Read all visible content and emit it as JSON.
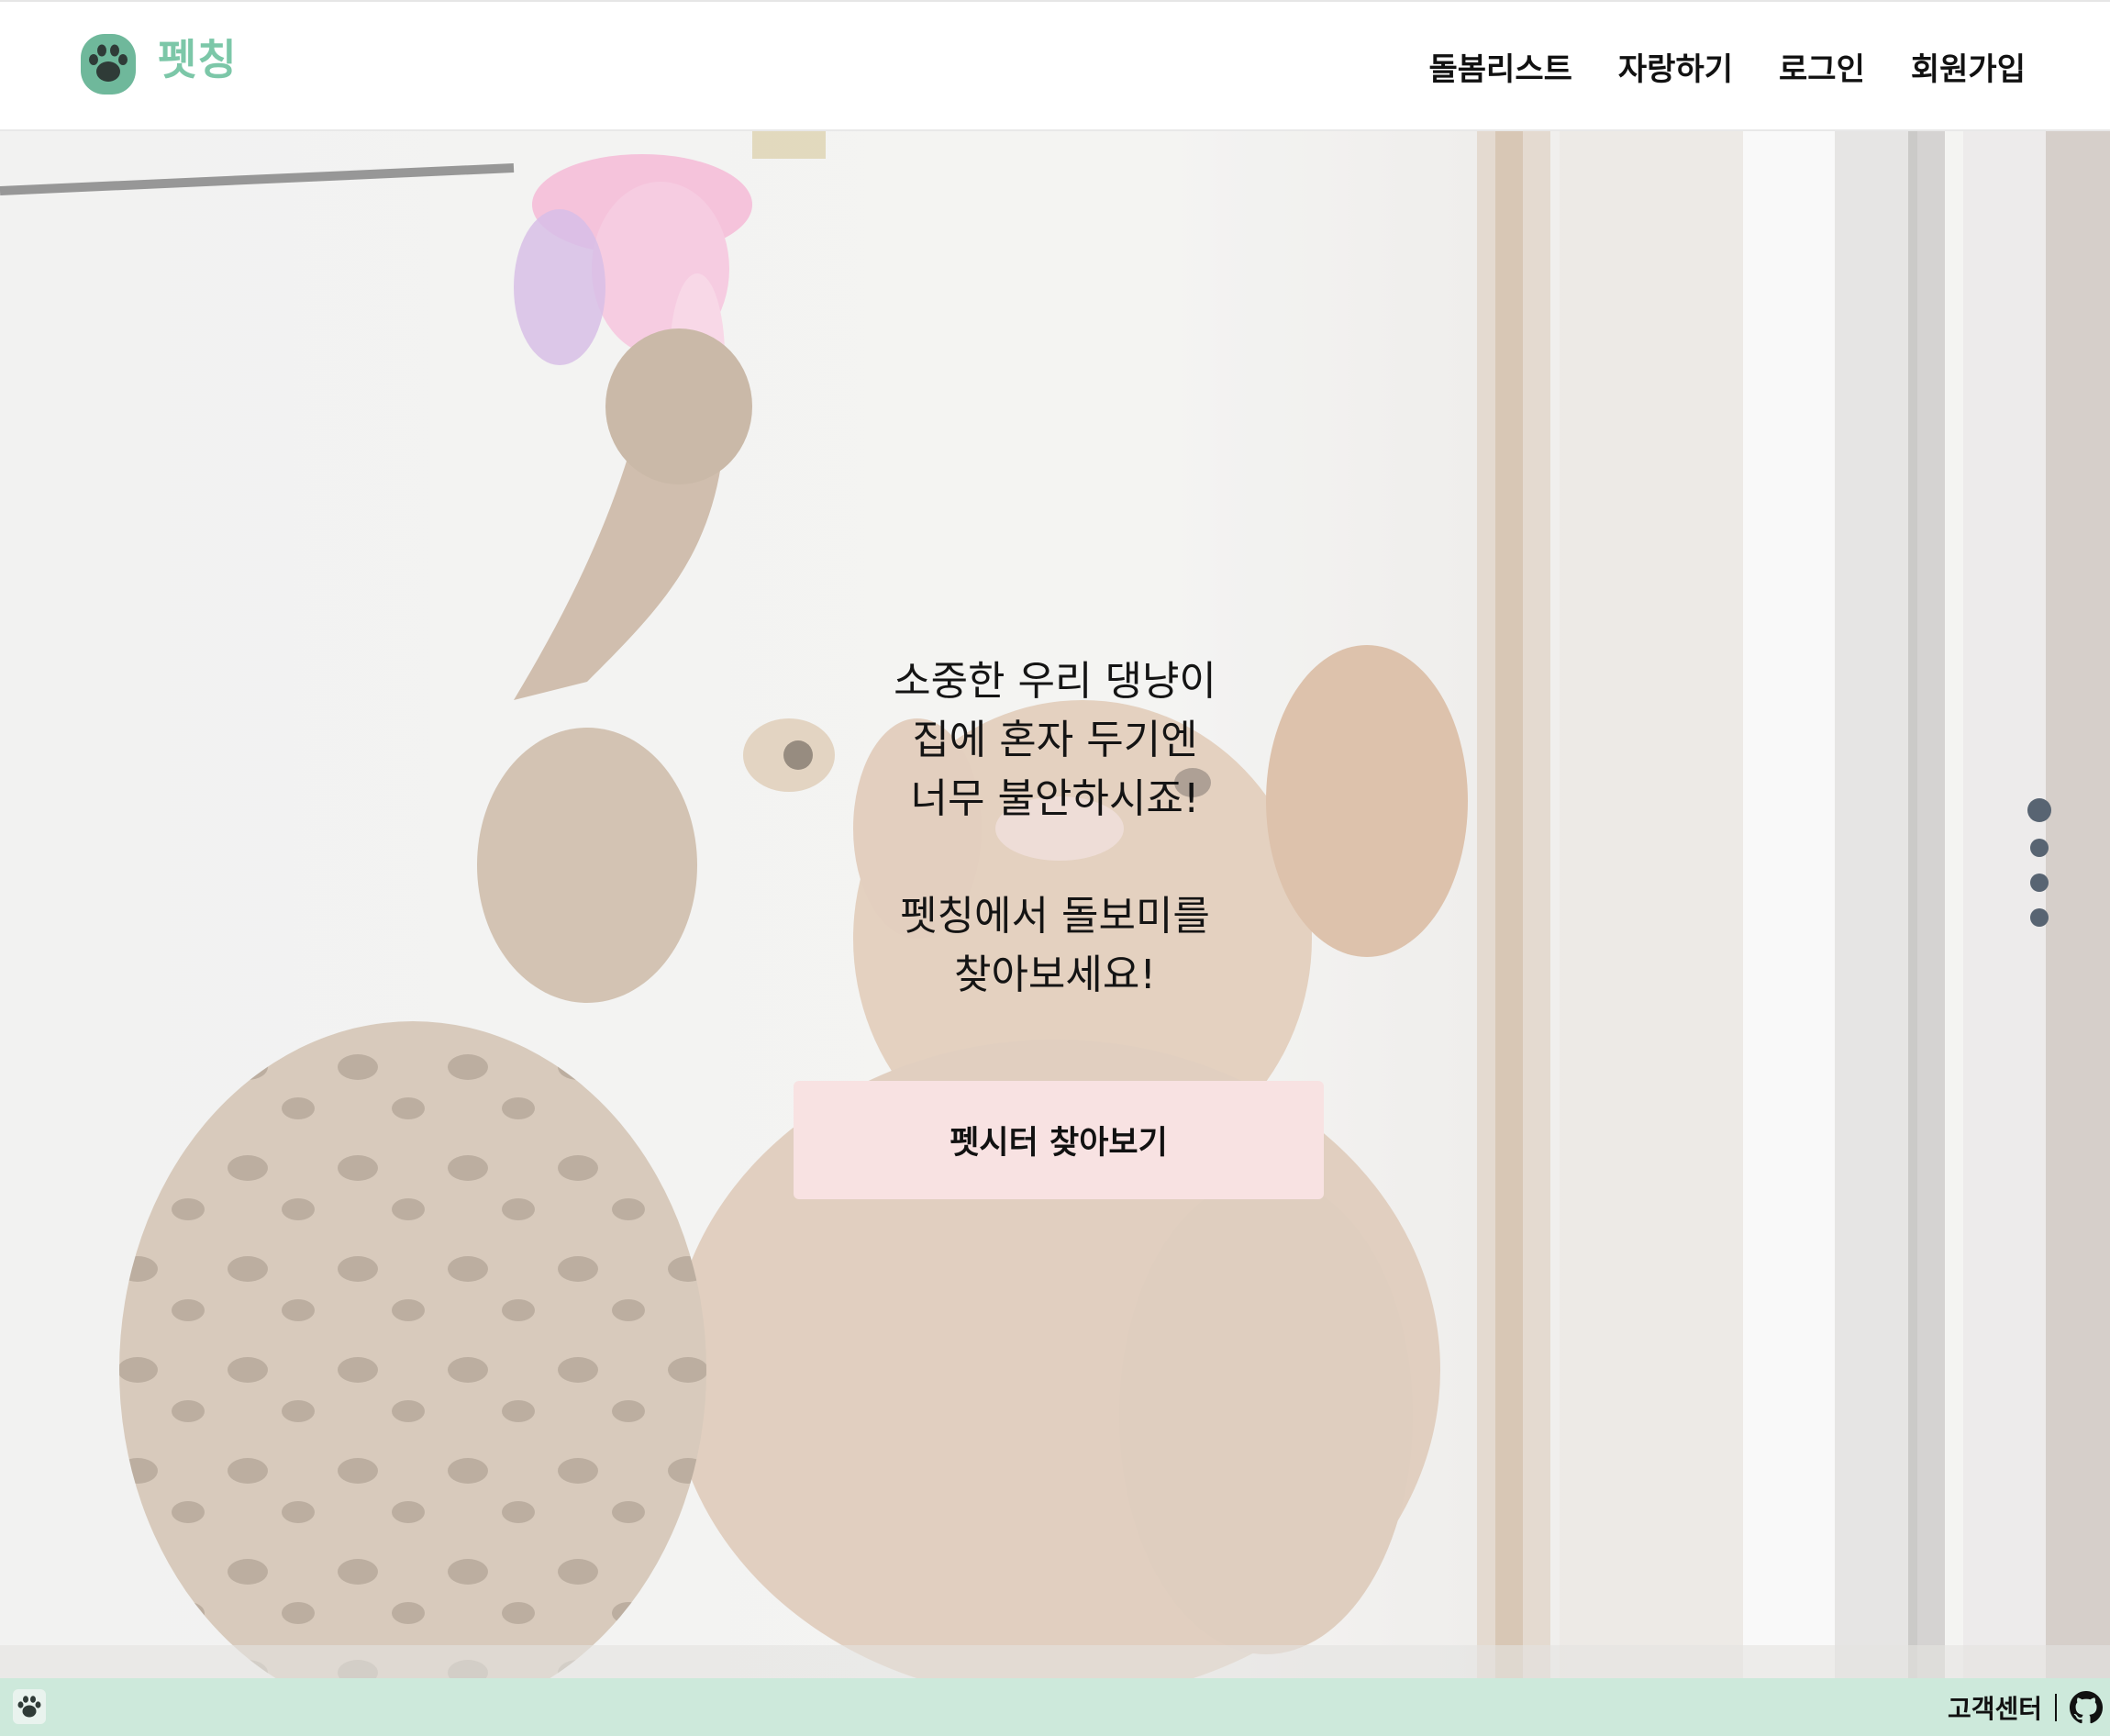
{
  "brand": {
    "name": "펫칭",
    "logo_icon": "paw-icon",
    "accent_color": "#7cc7a8"
  },
  "nav": {
    "items": [
      {
        "label": "돌봄리스트"
      },
      {
        "label": "자랑하기"
      },
      {
        "label": "로그인"
      },
      {
        "label": "회원가입"
      }
    ]
  },
  "hero": {
    "lines": [
      "소중한 우리 댕냥이",
      "집에 혼자 두기엔",
      "너무 불안하시죠!"
    ],
    "lines2": [
      "펫칭에서 돌보미를",
      "찾아보세요!"
    ],
    "cta_label": "펫시터 찾아보기",
    "cta_color": "#f8e2e2",
    "slider_count": 4,
    "slider_active": 1
  },
  "footer": {
    "logo_icon": "paw-icon",
    "customer_center": "고객센터",
    "github_icon": "github-icon",
    "background": "#cde9db"
  }
}
